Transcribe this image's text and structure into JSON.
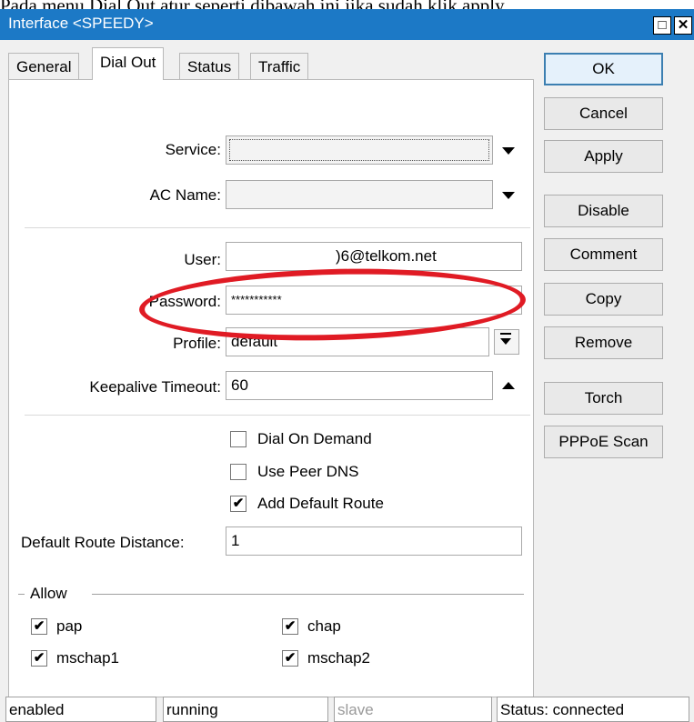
{
  "caption": "Pada menu Dial Out atur seperti dibawah ini jika sudah klik apply",
  "window": {
    "title": "Interface <SPEEDY>",
    "restore_glyph": "□",
    "close_glyph": "✕"
  },
  "tabs": [
    "General",
    "Dial Out",
    "Status",
    "Traffic"
  ],
  "form": {
    "service_label": "Service:",
    "service_value": "",
    "ac_name_label": "AC Name:",
    "ac_name_value": "",
    "user_label": "User:",
    "user_value": ")6@telkom.net",
    "password_label": "Password:",
    "password_value": "***********",
    "profile_label": "Profile:",
    "profile_value": "default",
    "keepalive_label": "Keepalive Timeout:",
    "keepalive_value": "60",
    "dial_on_demand": {
      "label": "Dial On Demand",
      "checked": false
    },
    "use_peer_dns": {
      "label": "Use Peer DNS",
      "checked": false
    },
    "add_default_route": {
      "label": "Add Default Route",
      "checked": true
    },
    "route_distance_label": "Default Route Distance:",
    "route_distance_value": "1"
  },
  "allow": {
    "title": "Allow",
    "pap": "pap",
    "chap": "chap",
    "mschap1": "mschap1",
    "mschap2": "mschap2"
  },
  "check_glyph": "✔",
  "buttons": [
    "OK",
    "Cancel",
    "Apply",
    "Disable",
    "Comment",
    "Copy",
    "Remove",
    "Torch",
    "PPPoE Scan"
  ],
  "statusbar": [
    "enabled",
    "running",
    "slave",
    "Status: connected"
  ],
  "colors": {
    "titlebar": "#1c79c6",
    "annotation": "#e01b24"
  }
}
